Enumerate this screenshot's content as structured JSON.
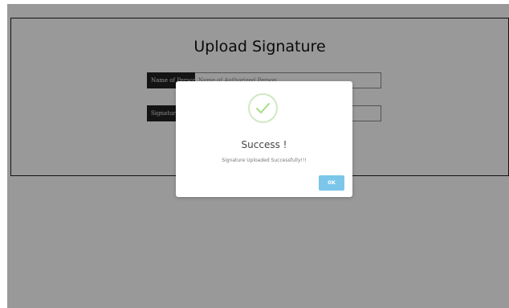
{
  "page": {
    "title": "Upload Signature",
    "fields": [
      {
        "label": "Name of Person",
        "placeholder": "Name of Authorized Person"
      },
      {
        "label": "Signature",
        "value": ""
      }
    ]
  },
  "modal": {
    "icon": "success-check-icon",
    "title": "Success !",
    "message": "Signature Uploaded Successfully!!!",
    "ok_label": "OK"
  },
  "colors": {
    "overlay": "#000000",
    "ok_button": "#7cc6ea",
    "check_stroke": "#a5dc86"
  }
}
